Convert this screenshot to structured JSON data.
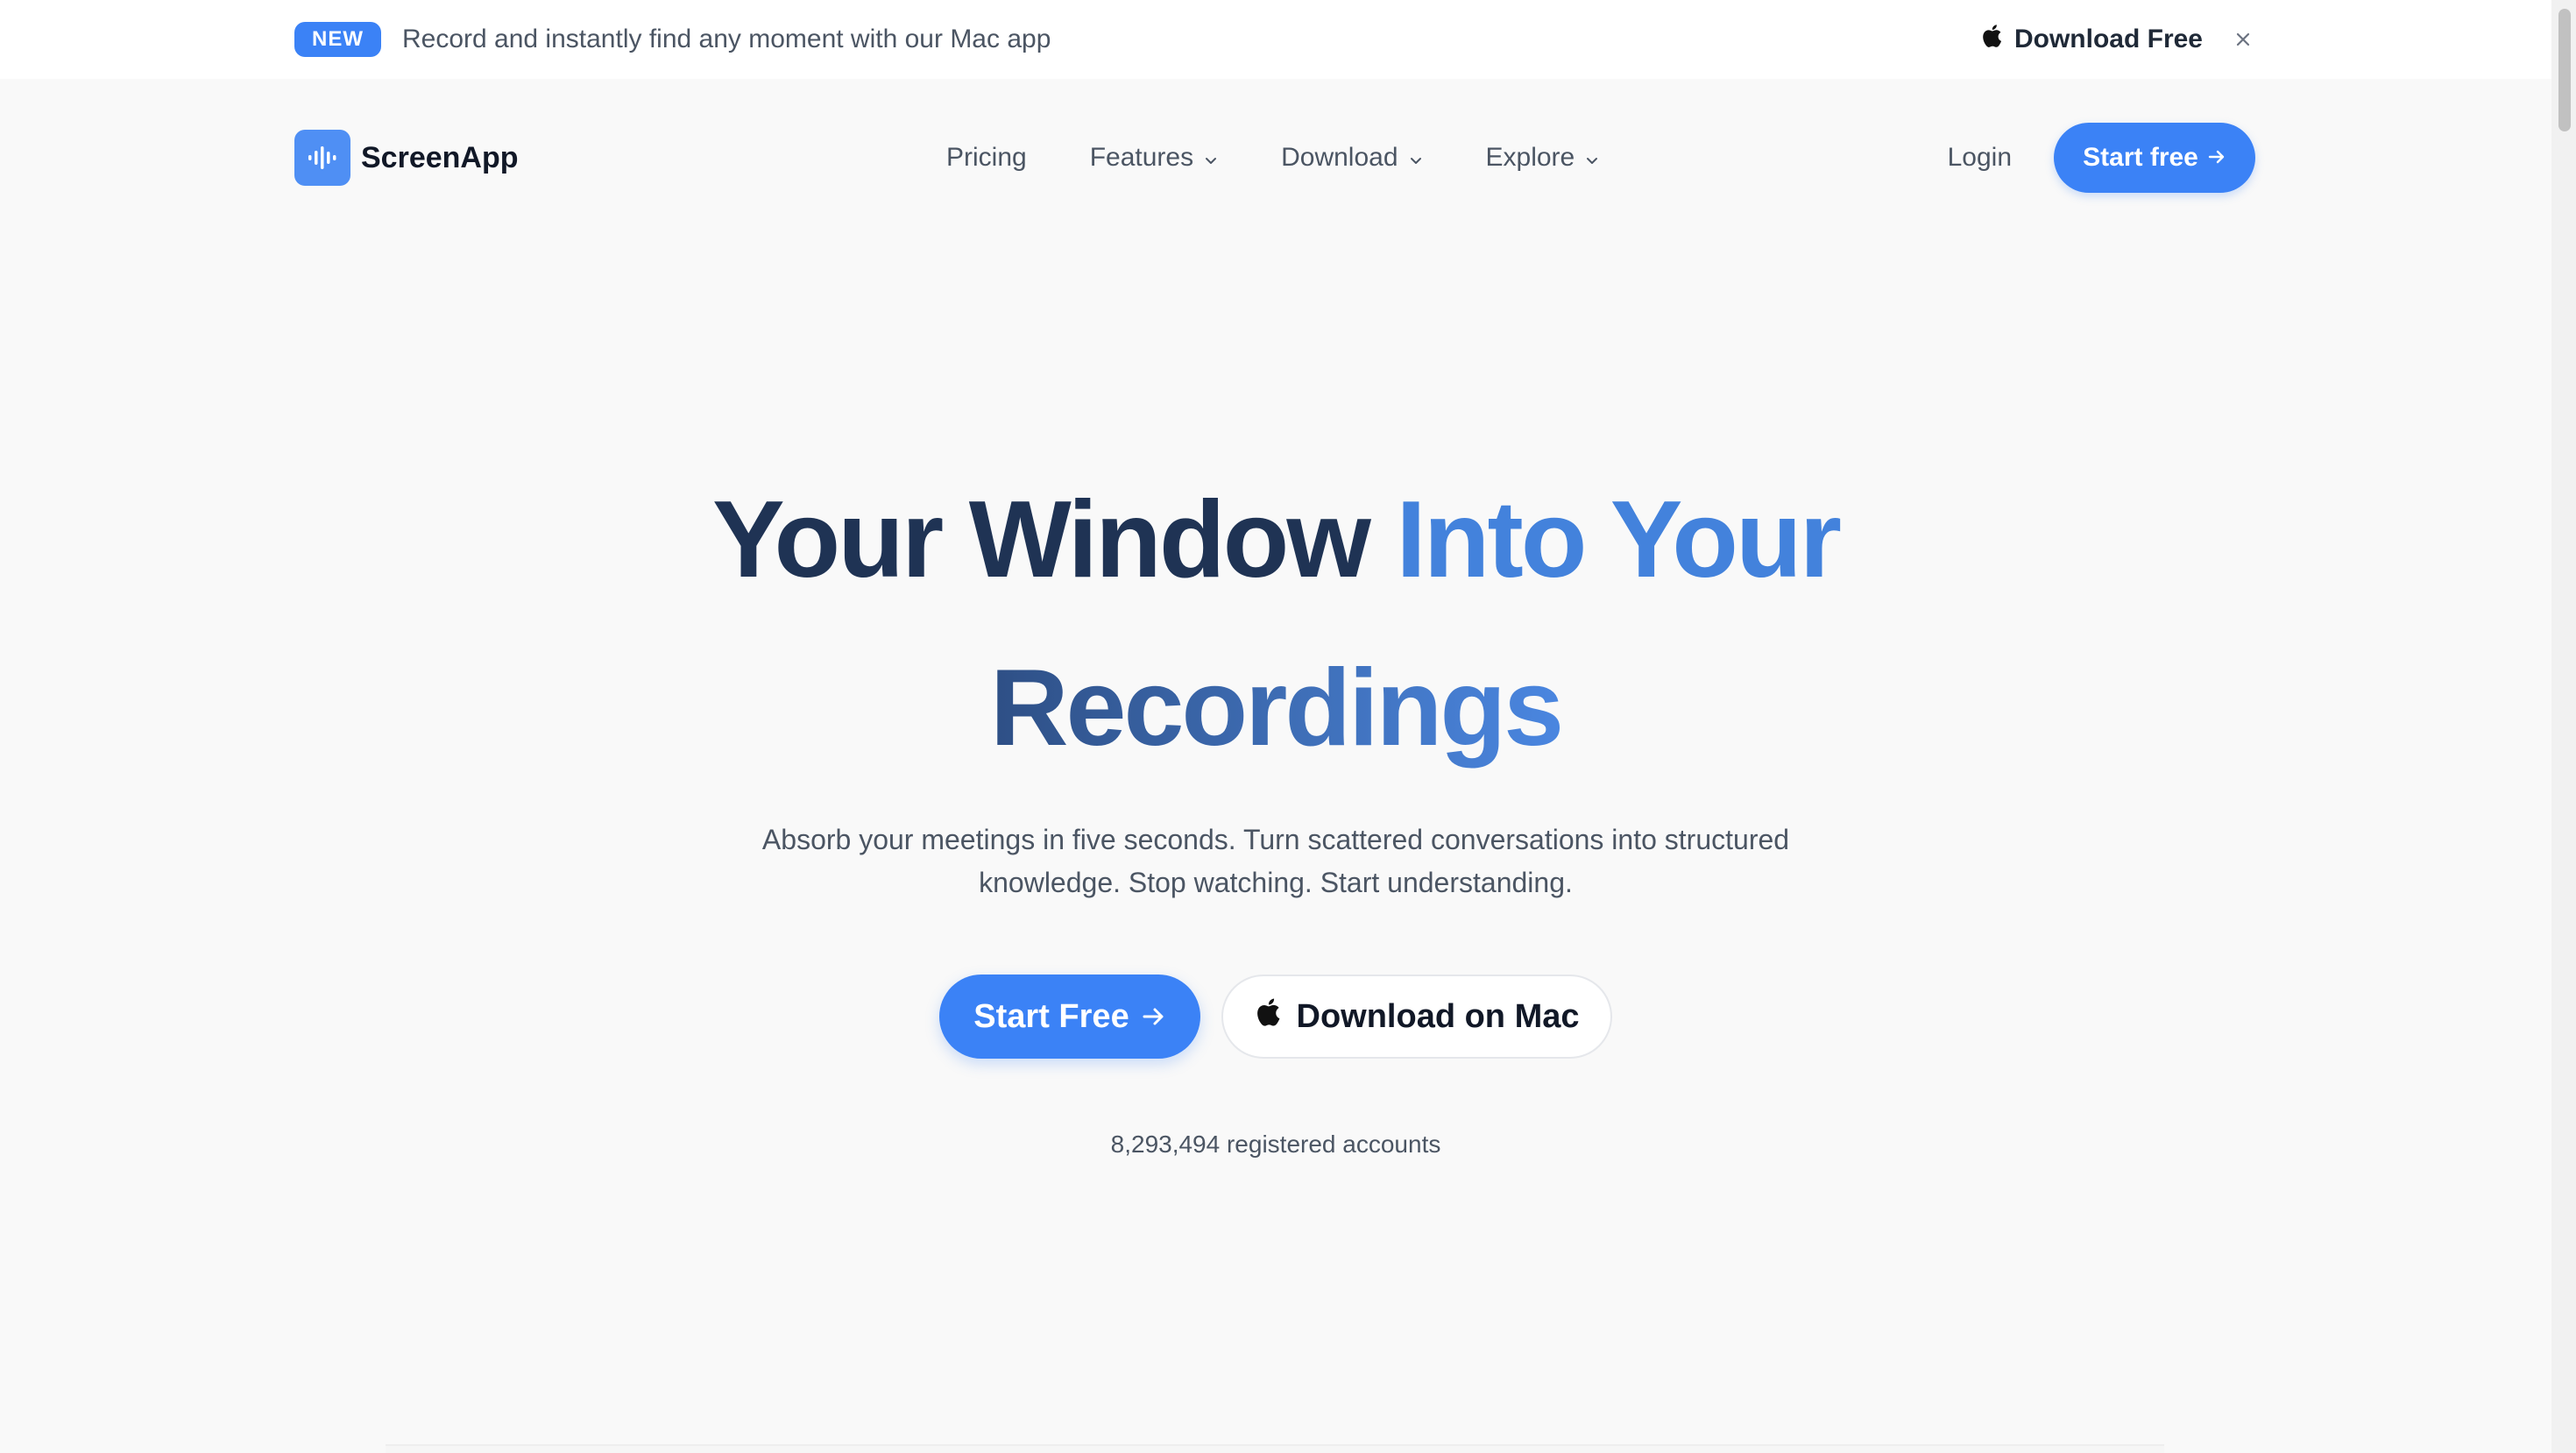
{
  "colors": {
    "accent": "#3b82f6",
    "title_dark": "#1f3354",
    "title_blue": "#4382dc"
  },
  "announcement": {
    "badge": "NEW",
    "text": "Record and instantly find any moment with our Mac app",
    "download_label": "Download Free",
    "download_icon": "apple-icon",
    "close_icon": "close-icon"
  },
  "nav": {
    "brand": "ScreenApp",
    "logo_icon": "waveform-icon",
    "items": [
      {
        "label": "Pricing",
        "has_dropdown": false
      },
      {
        "label": "Features",
        "has_dropdown": true
      },
      {
        "label": "Download",
        "has_dropdown": true
      },
      {
        "label": "Explore",
        "has_dropdown": true
      }
    ],
    "login": "Login",
    "cta": "Start free"
  },
  "hero": {
    "title_part1": "Your Window",
    "title_part2": "Into Your",
    "title_part3": "Recordings",
    "subtitle": "Absorb your meetings in five seconds. Turn scattered conversations into structured knowledge. Stop watching. Start understanding.",
    "cta_primary": "Start Free",
    "cta_secondary": "Download on Mac",
    "accounts": "8,293,494 registered accounts"
  }
}
